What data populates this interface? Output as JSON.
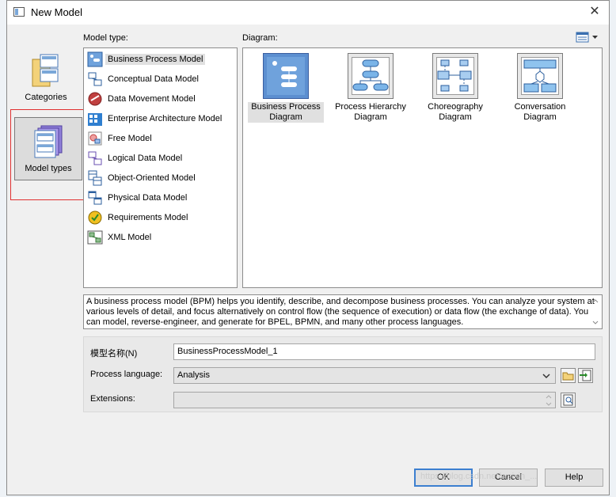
{
  "window": {
    "title": "New Model",
    "close": "✕"
  },
  "categories": [
    {
      "label": "Categories"
    },
    {
      "label": "Model types"
    }
  ],
  "model_type_label": "Model type:",
  "diagram_label": "Diagram:",
  "model_types": [
    {
      "label": "Business Process Model",
      "icon": "business-process-icon",
      "selected": true
    },
    {
      "label": "Conceptual Data Model",
      "icon": "conceptual-data-icon"
    },
    {
      "label": "Data Movement Model",
      "icon": "data-movement-icon"
    },
    {
      "label": "Enterprise Architecture Model",
      "icon": "enterprise-architecture-icon"
    },
    {
      "label": "Free Model",
      "icon": "free-model-icon"
    },
    {
      "label": "Logical Data Model",
      "icon": "logical-data-icon"
    },
    {
      "label": "Object-Oriented Model",
      "icon": "object-oriented-icon"
    },
    {
      "label": "Physical Data Model",
      "icon": "physical-data-icon"
    },
    {
      "label": "Requirements Model",
      "icon": "requirements-icon"
    },
    {
      "label": "XML Model",
      "icon": "xml-model-icon"
    }
  ],
  "diagrams": [
    {
      "line1": "Business Process",
      "line2": "Diagram",
      "selected": true
    },
    {
      "line1": "Process Hierarchy",
      "line2": "Diagram"
    },
    {
      "line1": "Choreography",
      "line2": "Diagram"
    },
    {
      "line1": "Conversation",
      "line2": "Diagram"
    }
  ],
  "description": "A business process model (BPM) helps you identify, describe, and decompose business processes. You can analyze your system at various levels of detail, and focus alternatively on control flow (the sequence of execution) or data flow (the exchange of data). You can model, reverse-engineer, and generate for BPEL, BPMN, and many other process languages.",
  "form": {
    "name_label": "模型名称(N)",
    "name_value": "BusinessProcessModel_1",
    "language_label": "Process language:",
    "language_value": "Analysis",
    "extensions_label": "Extensions:",
    "extensions_value": ""
  },
  "buttons": {
    "ok": "OK",
    "cancel": "Cancel",
    "help": "Help"
  },
  "watermark": "https://blog.csdn.net/weixin_...",
  "colors": {
    "selection_border": "#e03030",
    "default_button": "#3c7fd0"
  }
}
